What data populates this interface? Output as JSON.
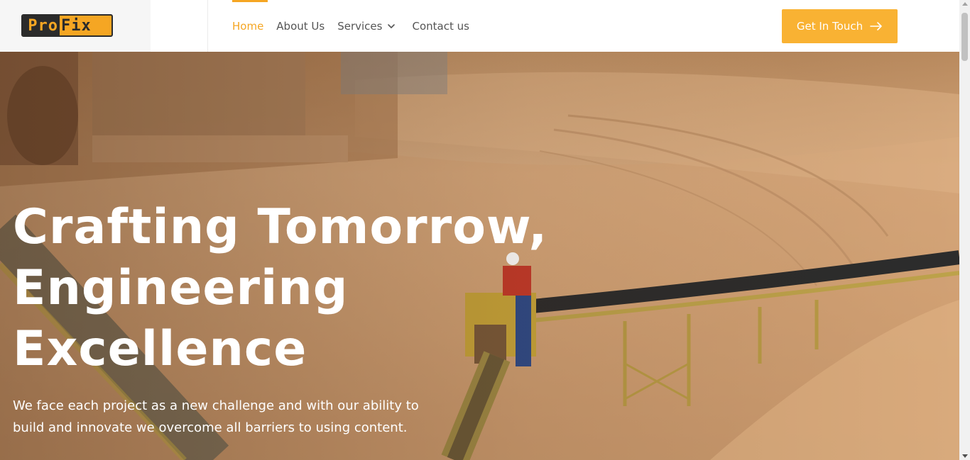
{
  "header": {
    "logo": {
      "part1": "Pro",
      "part2": "Fix"
    },
    "nav": [
      {
        "label": "Home",
        "active": true
      },
      {
        "label": "About Us",
        "active": false
      },
      {
        "label": "Services",
        "active": false,
        "has_dropdown": true
      },
      {
        "label": "Contact us",
        "active": false
      }
    ],
    "cta_label": "Get In Touch"
  },
  "hero": {
    "title_lines": [
      "Crafting Tomorrow,",
      "Engineering",
      "Excellence"
    ],
    "subtitle_line1": "We face each project as a new challenge and with our ability to",
    "subtitle_line2": "build and innovate we overcome all barriers to using content.",
    "background_image": "sand-mine-conveyor-worker"
  },
  "colors": {
    "accent": "#f9b233",
    "nav_text": "#555555",
    "nav_active": "#f5a623"
  },
  "icons": {
    "services_dropdown": "chevron-down-icon",
    "cta_arrow": "arrow-right-icon"
  }
}
